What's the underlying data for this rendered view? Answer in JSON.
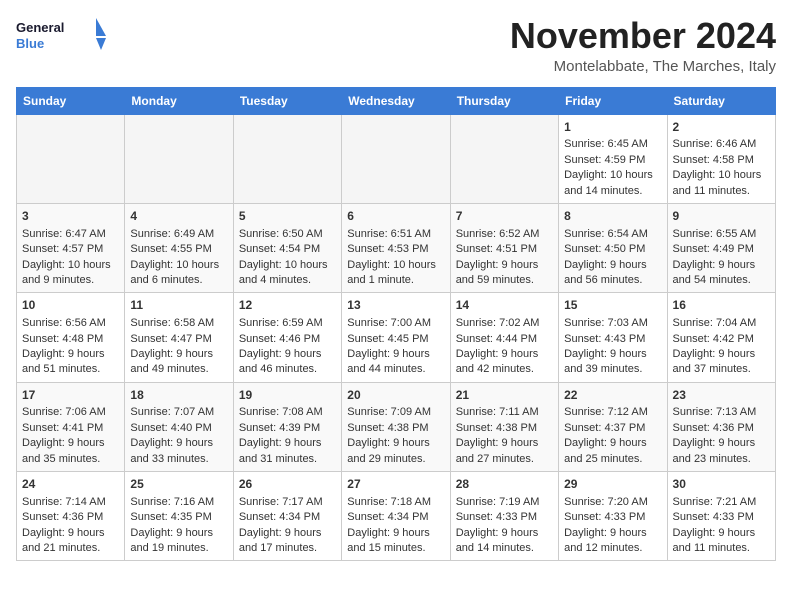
{
  "header": {
    "logo_general": "General",
    "logo_blue": "Blue",
    "month_title": "November 2024",
    "subtitle": "Montelabbate, The Marches, Italy"
  },
  "weekdays": [
    "Sunday",
    "Monday",
    "Tuesday",
    "Wednesday",
    "Thursday",
    "Friday",
    "Saturday"
  ],
  "weeks": [
    [
      {
        "day": "",
        "info": ""
      },
      {
        "day": "",
        "info": ""
      },
      {
        "day": "",
        "info": ""
      },
      {
        "day": "",
        "info": ""
      },
      {
        "day": "",
        "info": ""
      },
      {
        "day": "1",
        "info": "Sunrise: 6:45 AM\nSunset: 4:59 PM\nDaylight: 10 hours and 14 minutes."
      },
      {
        "day": "2",
        "info": "Sunrise: 6:46 AM\nSunset: 4:58 PM\nDaylight: 10 hours and 11 minutes."
      }
    ],
    [
      {
        "day": "3",
        "info": "Sunrise: 6:47 AM\nSunset: 4:57 PM\nDaylight: 10 hours and 9 minutes."
      },
      {
        "day": "4",
        "info": "Sunrise: 6:49 AM\nSunset: 4:55 PM\nDaylight: 10 hours and 6 minutes."
      },
      {
        "day": "5",
        "info": "Sunrise: 6:50 AM\nSunset: 4:54 PM\nDaylight: 10 hours and 4 minutes."
      },
      {
        "day": "6",
        "info": "Sunrise: 6:51 AM\nSunset: 4:53 PM\nDaylight: 10 hours and 1 minute."
      },
      {
        "day": "7",
        "info": "Sunrise: 6:52 AM\nSunset: 4:51 PM\nDaylight: 9 hours and 59 minutes."
      },
      {
        "day": "8",
        "info": "Sunrise: 6:54 AM\nSunset: 4:50 PM\nDaylight: 9 hours and 56 minutes."
      },
      {
        "day": "9",
        "info": "Sunrise: 6:55 AM\nSunset: 4:49 PM\nDaylight: 9 hours and 54 minutes."
      }
    ],
    [
      {
        "day": "10",
        "info": "Sunrise: 6:56 AM\nSunset: 4:48 PM\nDaylight: 9 hours and 51 minutes."
      },
      {
        "day": "11",
        "info": "Sunrise: 6:58 AM\nSunset: 4:47 PM\nDaylight: 9 hours and 49 minutes."
      },
      {
        "day": "12",
        "info": "Sunrise: 6:59 AM\nSunset: 4:46 PM\nDaylight: 9 hours and 46 minutes."
      },
      {
        "day": "13",
        "info": "Sunrise: 7:00 AM\nSunset: 4:45 PM\nDaylight: 9 hours and 44 minutes."
      },
      {
        "day": "14",
        "info": "Sunrise: 7:02 AM\nSunset: 4:44 PM\nDaylight: 9 hours and 42 minutes."
      },
      {
        "day": "15",
        "info": "Sunrise: 7:03 AM\nSunset: 4:43 PM\nDaylight: 9 hours and 39 minutes."
      },
      {
        "day": "16",
        "info": "Sunrise: 7:04 AM\nSunset: 4:42 PM\nDaylight: 9 hours and 37 minutes."
      }
    ],
    [
      {
        "day": "17",
        "info": "Sunrise: 7:06 AM\nSunset: 4:41 PM\nDaylight: 9 hours and 35 minutes."
      },
      {
        "day": "18",
        "info": "Sunrise: 7:07 AM\nSunset: 4:40 PM\nDaylight: 9 hours and 33 minutes."
      },
      {
        "day": "19",
        "info": "Sunrise: 7:08 AM\nSunset: 4:39 PM\nDaylight: 9 hours and 31 minutes."
      },
      {
        "day": "20",
        "info": "Sunrise: 7:09 AM\nSunset: 4:38 PM\nDaylight: 9 hours and 29 minutes."
      },
      {
        "day": "21",
        "info": "Sunrise: 7:11 AM\nSunset: 4:38 PM\nDaylight: 9 hours and 27 minutes."
      },
      {
        "day": "22",
        "info": "Sunrise: 7:12 AM\nSunset: 4:37 PM\nDaylight: 9 hours and 25 minutes."
      },
      {
        "day": "23",
        "info": "Sunrise: 7:13 AM\nSunset: 4:36 PM\nDaylight: 9 hours and 23 minutes."
      }
    ],
    [
      {
        "day": "24",
        "info": "Sunrise: 7:14 AM\nSunset: 4:36 PM\nDaylight: 9 hours and 21 minutes."
      },
      {
        "day": "25",
        "info": "Sunrise: 7:16 AM\nSunset: 4:35 PM\nDaylight: 9 hours and 19 minutes."
      },
      {
        "day": "26",
        "info": "Sunrise: 7:17 AM\nSunset: 4:34 PM\nDaylight: 9 hours and 17 minutes."
      },
      {
        "day": "27",
        "info": "Sunrise: 7:18 AM\nSunset: 4:34 PM\nDaylight: 9 hours and 15 minutes."
      },
      {
        "day": "28",
        "info": "Sunrise: 7:19 AM\nSunset: 4:33 PM\nDaylight: 9 hours and 14 minutes."
      },
      {
        "day": "29",
        "info": "Sunrise: 7:20 AM\nSunset: 4:33 PM\nDaylight: 9 hours and 12 minutes."
      },
      {
        "day": "30",
        "info": "Sunrise: 7:21 AM\nSunset: 4:33 PM\nDaylight: 9 hours and 11 minutes."
      }
    ]
  ]
}
